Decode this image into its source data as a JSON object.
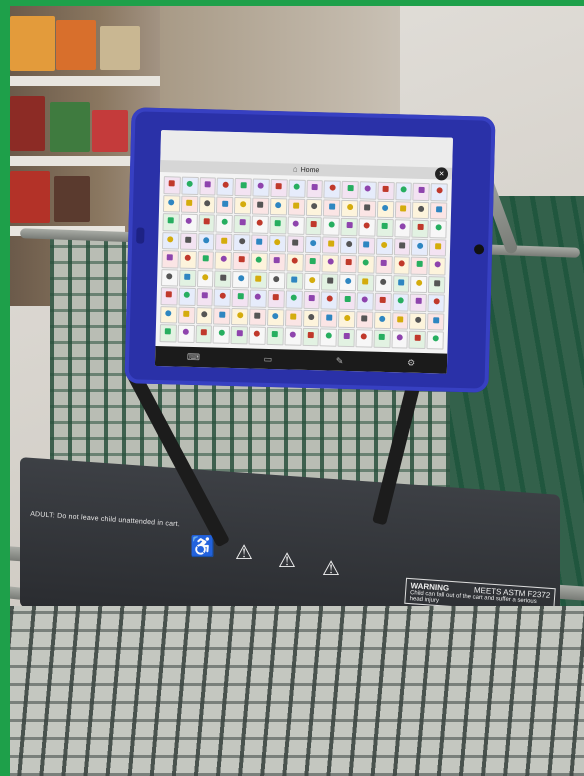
{
  "scene": {
    "tablet": {
      "screen_title": "Home",
      "close_label": "×",
      "home_icon": "home-icon",
      "grid_rows": 9,
      "grid_cols": 16,
      "footer_icons": [
        "keyboard-icon",
        "chat-icon",
        "pencil-icon",
        "settings-icon"
      ]
    },
    "cart_seat": {
      "safety_notice": "ADULT: Do not leave child unattended in cart.",
      "warning_title": "WARNING",
      "warning_text": "Child can fall out of the cart and suffer a serious head injury",
      "standard": "MEETS ASTM F2372"
    },
    "colors": {
      "border": "#1ea04a",
      "tablet_case": "#2a31a8",
      "cart_green": "#33614b"
    }
  }
}
